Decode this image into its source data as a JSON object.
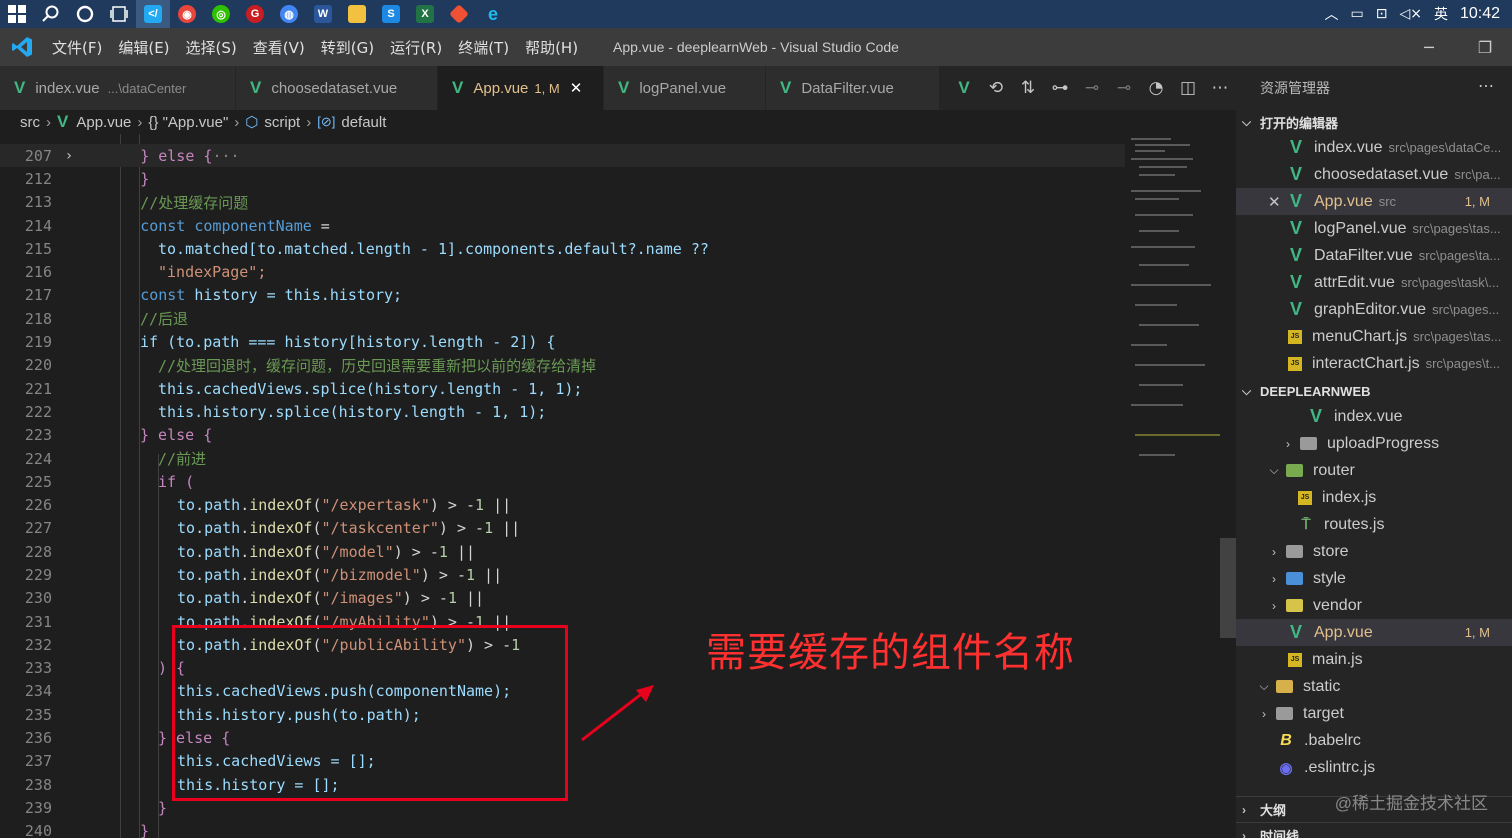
{
  "taskbar": {
    "tray_ime": "英",
    "clock": "10:42"
  },
  "titlebar": {
    "menus": [
      "文件(F)",
      "编辑(E)",
      "选择(S)",
      "查看(V)",
      "转到(G)",
      "运行(R)",
      "终端(T)",
      "帮助(H)"
    ],
    "title": "App.vue - deeplearnWeb - Visual Studio Code"
  },
  "tabs": [
    {
      "label": "index.vue",
      "desc": "...\\dataCenter",
      "mod": "",
      "close": ""
    },
    {
      "label": "choosedataset.vue",
      "desc": "",
      "mod": "",
      "close": ""
    },
    {
      "label": "App.vue",
      "desc": "",
      "mod": "1, M",
      "close": "✕"
    },
    {
      "label": "logPanel.vue",
      "desc": "",
      "mod": "",
      "close": ""
    },
    {
      "label": "DataFilter.vue",
      "desc": "",
      "mod": "",
      "close": ""
    }
  ],
  "breadcrumb": {
    "folder": "src",
    "file": "App.vue",
    "object": "{} \"App.vue\"",
    "script": "script",
    "default": "default"
  },
  "code": {
    "line_numbers": [
      "207",
      "212",
      "213",
      "214",
      "215",
      "216",
      "217",
      "218",
      "219",
      "220",
      "221",
      "222",
      "223",
      "224",
      "225",
      "226",
      "227",
      "228",
      "229",
      "230",
      "231",
      "232",
      "233",
      "234",
      "235",
      "236",
      "237",
      "238",
      "239",
      "240"
    ],
    "l207": "} else {",
    "l207_ellipsis": "···",
    "l212": "}",
    "l213": "//处理缓存问题",
    "l214_kw": "const",
    "l214_name": "componentName",
    "l214_op": " =",
    "l215": "to.matched[to.matched.length - 1].components.default?.name ??",
    "l216": "\"indexPage\";",
    "l217_kw": "const",
    "l217_rest": " history = this.history;",
    "l218": "//后退",
    "l219": "if (to.path === history[history.length - 2]) {",
    "l220": "//处理回退时，缓存问题，历史回退需要重新把以前的缓存给清掉",
    "l221": "this.cachedViews.splice(history.length - 1, 1);",
    "l222": "this.history.splice(history.length - 1, 1);",
    "l223": "} else {",
    "l224": "//前进",
    "l225": "if (",
    "paths": [
      "\"/expertask\"",
      "\"/taskcenter\"",
      "\"/model\"",
      "\"/bizmodel\"",
      "\"/images\"",
      "\"/myAbility\"",
      "\"/publicAbility\""
    ],
    "l233": ") {",
    "l234": "this.cachedViews.push(componentName);",
    "l235": "this.history.push(to.path);",
    "l236": "} else {",
    "l237": "this.cachedViews = [];",
    "l238": "this.history = [];",
    "l239": "}",
    "l240": "}"
  },
  "annotation": "需要缓存的组件名称",
  "sidebar": {
    "title": "资源管理器",
    "open_editors_title": "打开的编辑器",
    "open_editors": [
      {
        "name": "index.vue",
        "path": "src\\pages\\dataCe...",
        "icon": "vue",
        "badge": ""
      },
      {
        "name": "choosedataset.vue",
        "path": "src\\pa...",
        "icon": "vue",
        "badge": ""
      },
      {
        "name": "App.vue",
        "path": "src",
        "icon": "vue",
        "badge": "1, M"
      },
      {
        "name": "logPanel.vue",
        "path": "src\\pages\\tas...",
        "icon": "vue",
        "badge": ""
      },
      {
        "name": "DataFilter.vue",
        "path": "src\\pages\\ta...",
        "icon": "vue",
        "badge": ""
      },
      {
        "name": "attrEdit.vue",
        "path": "src\\pages\\task\\...",
        "icon": "vue",
        "badge": ""
      },
      {
        "name": "graphEditor.vue",
        "path": "src\\pages...",
        "icon": "vue",
        "badge": ""
      },
      {
        "name": "menuChart.js",
        "path": "src\\pages\\tas...",
        "icon": "js",
        "badge": ""
      },
      {
        "name": "interactChart.js",
        "path": "src\\pages\\t...",
        "icon": "js",
        "badge": ""
      }
    ],
    "project_title": "DEEPLEARNWEB",
    "tree": [
      {
        "name": "index.vue",
        "badge": ""
      },
      {
        "name": "uploadProgress",
        "badge": ""
      },
      {
        "name": "router",
        "badge": ""
      },
      {
        "name": "index.js",
        "badge": ""
      },
      {
        "name": "routes.js",
        "badge": ""
      },
      {
        "name": "store",
        "badge": ""
      },
      {
        "name": "style",
        "badge": ""
      },
      {
        "name": "vendor",
        "badge": ""
      },
      {
        "name": "App.vue",
        "badge": "1, M"
      },
      {
        "name": "main.js",
        "badge": ""
      },
      {
        "name": "static",
        "badge": ""
      },
      {
        "name": "target",
        "badge": ""
      },
      {
        "name": ".babelrc",
        "badge": ""
      },
      {
        "name": ".eslintrc.js",
        "badge": ""
      }
    ],
    "outline_title": "大纲",
    "timeline_title": "时间线",
    "watermark": "@稀土掘金技术社区"
  },
  "colors": {
    "accent_red": "#e8001c",
    "vue_green": "#41b883",
    "modified_yellow": "#e2c08d"
  }
}
